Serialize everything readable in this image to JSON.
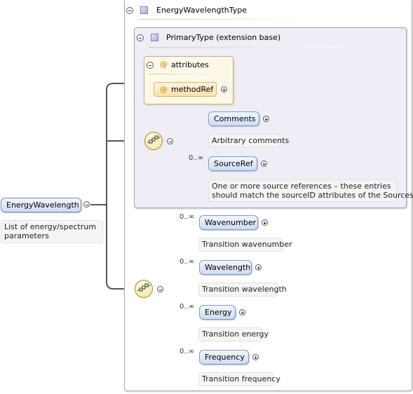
{
  "root": {
    "name": "EnergyWavelength",
    "annotation_line1": "List of energy/spectrum",
    "annotation_line2": "parameters"
  },
  "complex_type": {
    "name": "EnergyWavelengthType"
  },
  "base_type": {
    "name": "PrimaryType (extension base)"
  },
  "attributes": {
    "label": "attributes",
    "items": [
      "methodRef"
    ]
  },
  "inner_sequence": {
    "elements": [
      {
        "name": "Comments",
        "cardinality": "",
        "annotation_line1": "Arbitrary comments",
        "annotation_line2": ""
      },
      {
        "name": "SourceRef",
        "cardinality": "0..∞",
        "annotation_line1": "One or more source references – these entries",
        "annotation_line2": "should match the sourceID attributes of the Sources"
      }
    ]
  },
  "outer_sequence": {
    "elements": [
      {
        "name": "Wavenumber",
        "cardinality": "0..∞",
        "annotation": "Transition wavenumber"
      },
      {
        "name": "Wavelength",
        "cardinality": "0..∞",
        "annotation": "Transition wavelength"
      },
      {
        "name": "Energy",
        "cardinality": "0..∞",
        "annotation": "Transition energy"
      },
      {
        "name": "Frequency",
        "cardinality": "0..∞",
        "annotation": "Transition frequency"
      }
    ]
  },
  "icons": {
    "type": "type-square-icon",
    "attribute": "at-sign-icon",
    "sequence": "sequence-compositor-icon",
    "collapse": "minus-circle-icon",
    "expand": "plus-circle-icon"
  },
  "colors": {
    "element_fill": "#cfdcf1",
    "element_border": "#7e9cc7",
    "base_fill": "#efedf5",
    "attribute_fill": "#fdf8e8",
    "connector": "#555555"
  }
}
